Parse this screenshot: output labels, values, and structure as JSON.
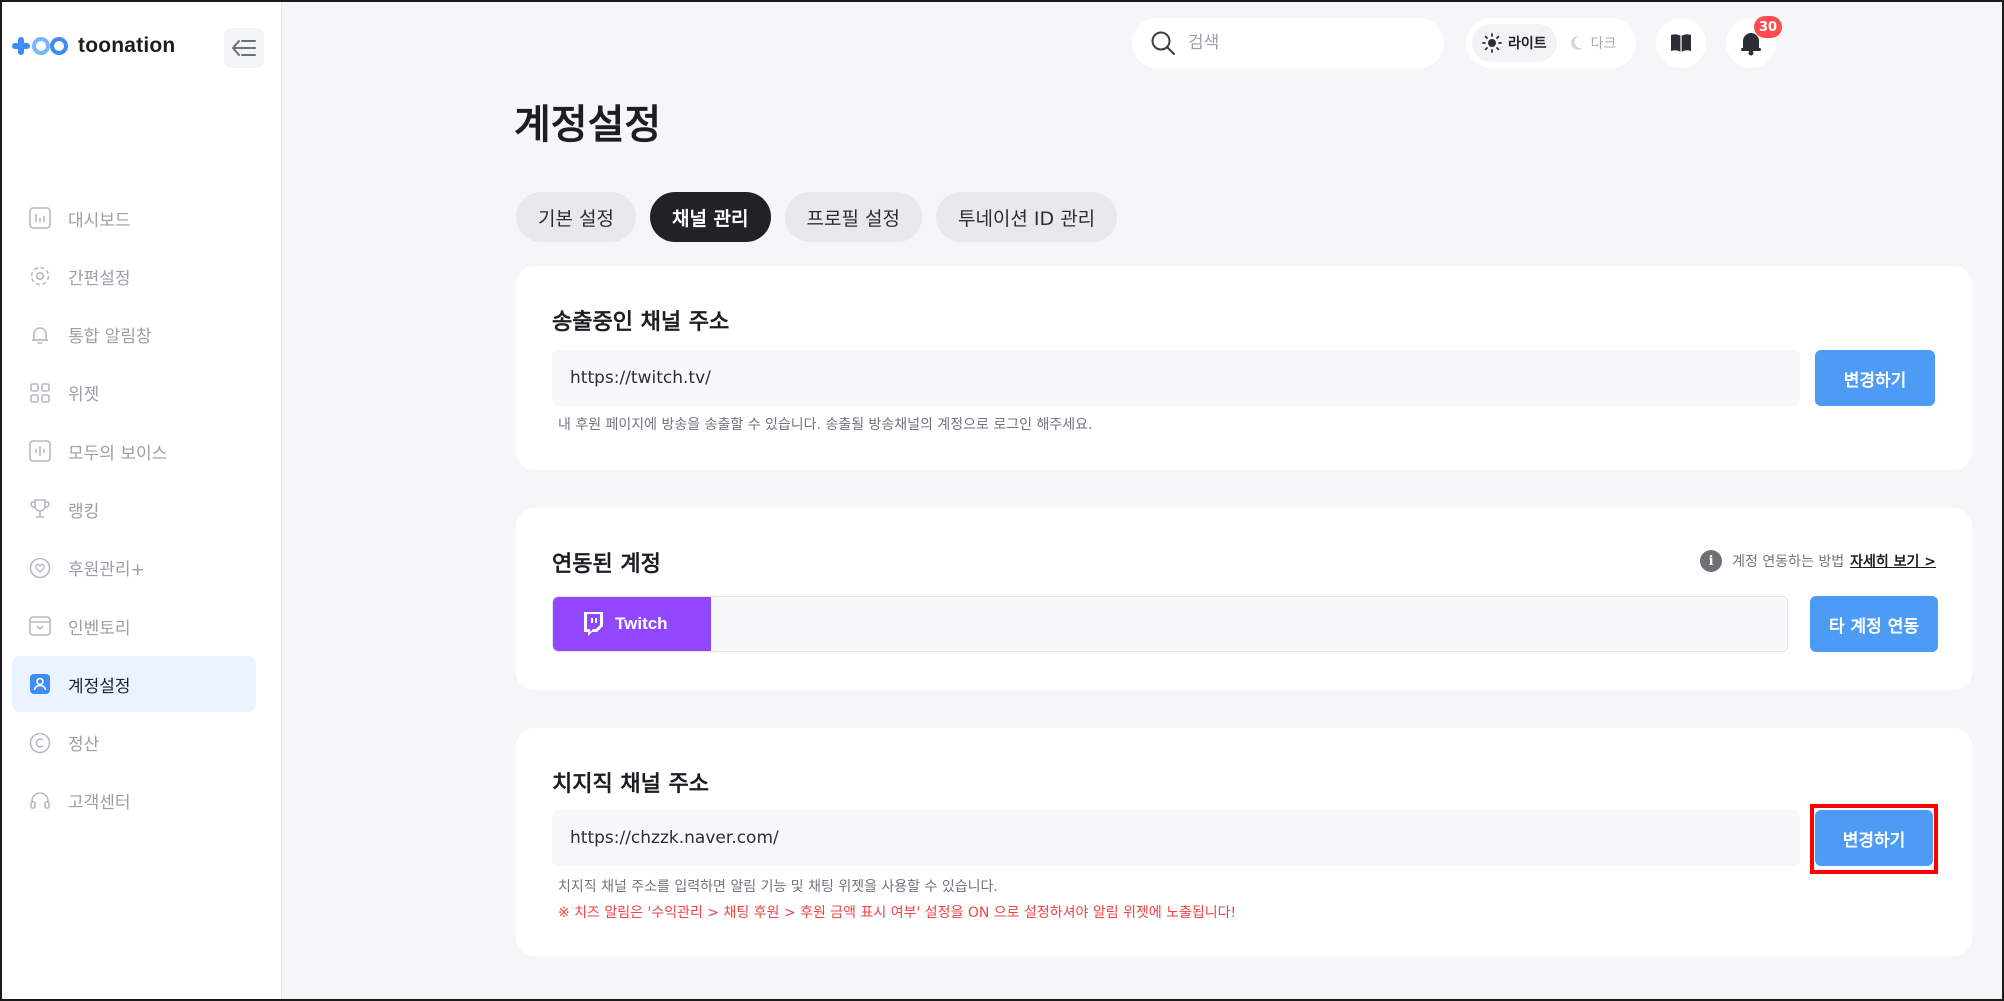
{
  "brand": {
    "name": "toonation"
  },
  "sidebar": {
    "items": [
      {
        "label": "대시보드",
        "icon": "chart-icon"
      },
      {
        "label": "간편설정",
        "icon": "gear-icon"
      },
      {
        "label": "통합 알림창",
        "icon": "bell-icon"
      },
      {
        "label": "위젯",
        "icon": "grid-icon"
      },
      {
        "label": "모두의 보이스",
        "icon": "voice-icon"
      },
      {
        "label": "랭킹",
        "icon": "trophy-icon"
      },
      {
        "label": "후원관리+",
        "icon": "heart-icon"
      },
      {
        "label": "인벤토리",
        "icon": "inventory-icon"
      },
      {
        "label": "계정설정",
        "icon": "user-icon",
        "active": true
      },
      {
        "label": "정산",
        "icon": "copyright-icon"
      },
      {
        "label": "고객센터",
        "icon": "headset-icon"
      }
    ]
  },
  "topbar": {
    "search_placeholder": "검색",
    "theme_light": "라이트",
    "theme_dark": "다크",
    "notification_count": "30"
  },
  "page": {
    "title": "계정설정",
    "tabs": [
      {
        "label": "기본 설정"
      },
      {
        "label": "채널 관리",
        "active": true
      },
      {
        "label": "프로필 설정"
      },
      {
        "label": "투네이션 ID 관리"
      }
    ]
  },
  "broadcast": {
    "title": "송출중인 채널 주소",
    "url": "https://twitch.tv/",
    "button": "변경하기",
    "help": "내 후원 페이지에 방송을 송출할 수 있습니다. 송출될 방송채널의 계정으로 로그인 해주세요."
  },
  "linked": {
    "title": "연동된 계정",
    "howto_text": "계정 연동하는 방법",
    "howto_link": "자세히 보기 >",
    "platform": "Twitch",
    "button": "타 계정 연동"
  },
  "chzzk": {
    "title": "치지직 채널 주소",
    "url": "https://chzzk.naver.com/",
    "button": "변경하기",
    "help": "치지직 채널 주소를 입력하면 알림 기능 및 채팅 위젯을 사용할 수 있습니다.",
    "warning": "※ 치즈 알림은 '수익관리 > 채팅 후원 > 후원 금액 표시 여부' 설정을 ON 으로 설정하셔야 알림 위젯에 노출됩니다!"
  },
  "colors": {
    "accent_blue": "#4e9bf5",
    "twitch_purple": "#9146ff",
    "warning_red": "#ef4444",
    "highlight": "#ff0000"
  }
}
